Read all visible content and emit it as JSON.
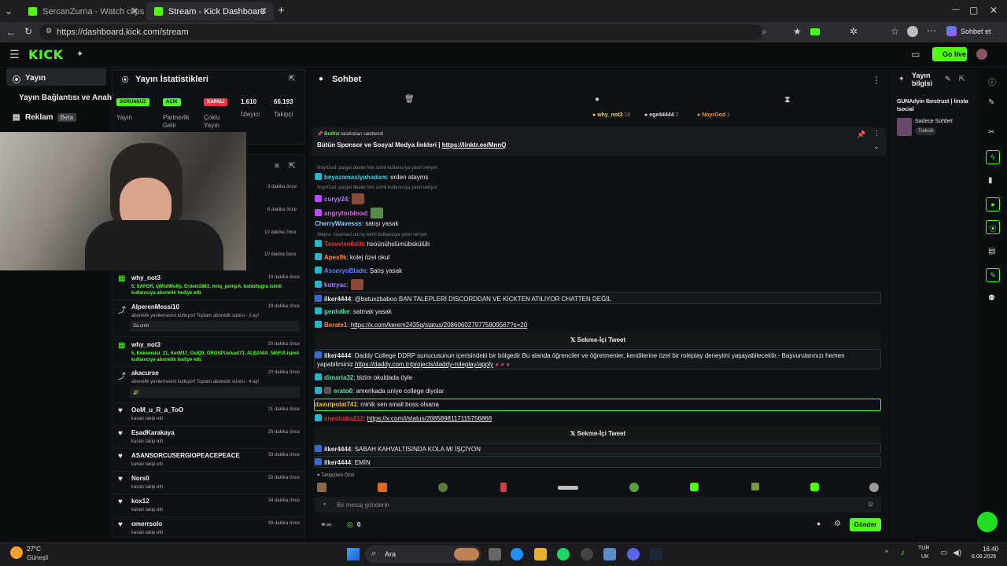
{
  "browser": {
    "tabs": [
      {
        "label": "SercanZurna - Watch clips on Kick"
      },
      {
        "label": "Stream - Kick Dashboard"
      }
    ],
    "url": "https://dashboard.kick.com/stream",
    "profile_label": "Sohbet et"
  },
  "header": {
    "logo": "KICK",
    "go_live": "Go live"
  },
  "sidebar": {
    "items": [
      {
        "label": "Yayın"
      },
      {
        "label": "Yayın Bağlantısı ve Anahtarı"
      },
      {
        "label": "Reklam",
        "badge": "Beta"
      }
    ]
  },
  "stats": {
    "title": "Yayın İstatistikleri",
    "cells": [
      {
        "badge": "SORUNSUZ",
        "label": "Yayın"
      },
      {
        "badge": "AÇIK",
        "label": "Partnerlik Gelir"
      },
      {
        "badge": "KAPALI",
        "label": "Çoklu Yayın"
      },
      {
        "value": "1.610",
        "label": "İzleyici"
      },
      {
        "value": "66.193",
        "label": "Takipçi"
      }
    ]
  },
  "activity": {
    "times_top": [
      "3 dakika önce",
      "6 dakika önce",
      "10 dakika önce",
      "10 dakika önce"
    ],
    "events": [
      {
        "user": "why_not3",
        "sub": "5, SAFOR, qWildWolfp, Erdem3883, mnq_pompA, hobbitugra isimli kullanıcıya abonelik hediye etti.",
        "time": "19 dakika önce"
      },
      {
        "user": "AlperenMessi10",
        "sub": "abonelik yenilemesini kutluyor! Toplam abonelik süresi - 3 ay!",
        "time": "19 dakika önce",
        "msg": "Sa cnm"
      },
      {
        "user": "why_not3",
        "sub": "5, Kekemsisi_21, KerM17, OsiQ9, OROSPUelvad73, ALBANIA_MAFIA isimli kullanıcıya abonelik hediye etti.",
        "time": "20 dakika önce"
      },
      {
        "user": "akacurse",
        "sub": "abonelik yenilemesini kutluyor! Toplam abonelik süresi - 4 ay!",
        "time": "20 dakika önce",
        "msg": "🎉"
      },
      {
        "user": "OoM_u_R_a_ToO",
        "sub": "kanalı takip etti",
        "time": "21 dakika önce"
      },
      {
        "user": "EsadKarakaya",
        "sub": "kanalı takip etti",
        "time": "25 dakika önce"
      },
      {
        "user": "ASANSORCUSERGIOPEACEPEACE",
        "sub": "kanalı takip etti",
        "time": "33 dakika önce"
      },
      {
        "user": "Nors0",
        "sub": "kanalı takip etti",
        "time": "33 dakika önce"
      },
      {
        "user": "kox12",
        "sub": "kanalı takip etti",
        "time": "34 dakika önce"
      },
      {
        "user": "omerrsolo",
        "sub": "kanalı takip etti",
        "time": "39 dakika önce"
      }
    ]
  },
  "chat": {
    "title": "Sohbet",
    "top_gifters": [
      {
        "name": "why_not3",
        "count": "16"
      },
      {
        "name": "ege44444",
        "count": "2"
      },
      {
        "name": "NoyrGod",
        "count": "1"
      }
    ],
    "pinned_by": "BotRix",
    "pinned_by_suffix": "tarafından sabitlendi",
    "pinned_text": "Bütün Sponsor ve Sosyal Medya linkleri |",
    "pinned_link": "https://linktr.ee/MnnQ",
    "messages": [
      {
        "reply": "NoyrGod: pargel dealer kim isimli kullanıcıya yanıt veriyor"
      },
      {
        "user": "beyazamasiyahadam",
        "text": "erden atayms"
      },
      {
        "reply": "NoyrGod: pargel dealer kim isimli kullanıcıya yanıt veriyor"
      },
      {
        "user": "curyy24",
        "text": ""
      },
      {
        "user": "angryforblood",
        "text": ""
      },
      {
        "user": "CherryWavesss",
        "text": "satışı yasak"
      },
      {
        "reply": "Aleyra: nisantasi uni rp isimli kullanıcıya yanıt veriyor"
      },
      {
        "user": "Tasvelen8dilt",
        "text": "hsoünühslümübskülüb"
      },
      {
        "user": "Apex9k",
        "text": "kolej özel okul"
      },
      {
        "user": "AsseryoBlade",
        "text": "Şatış yasak"
      },
      {
        "user": "kotryac",
        "text": ""
      },
      {
        "user": "ilker4444",
        "text": "@batuxzbaboo BAN TALEPLERİ DİSCORDDAN VE KİCKTEN ATILIYOR CHATTEN DEĞİL"
      },
      {
        "user": "genlolke",
        "text": "satmak yasak"
      },
      {
        "user": "Berate1",
        "link": "https://x.com/kerem2435q/status/2086060279775809567?s=20"
      },
      {
        "tweet": "Sekme-İçi Tweet"
      },
      {
        "user": "ilker4444",
        "text": "Daddy College DDRP sunucusunun içerisindeki bir bölgedir Bu alanda öğrenciler ve öğretmenler, kendilerine özel bir roleplay deneyimi yaşayabilecektir.- Başvurularınızı hemen"
      },
      {
        "text2": "yapabilirsiniz",
        "link": "https://daddy.com.tr/projects/daddy-roleplay/apply"
      },
      {
        "user": "dimaria32",
        "text": "bizim okuldada öyle"
      },
      {
        "user": "erato0",
        "text": "amerikada uniye college diyolar"
      },
      {
        "user": "davutpolat741",
        "text": "minik sen small boss olsana"
      },
      {
        "user": "enesbaba212",
        "link": "https://x.com/i/status/2085898117115756868"
      },
      {
        "tweet": "Sekme-İçi Tweet"
      },
      {
        "user": "ilker4444",
        "text": "SABAH KAHVALTISINDA KOLA MI İŞÇİYON"
      },
      {
        "user": "ilker4444",
        "text": "EMİN"
      }
    ],
    "emote_section": "Takipçilere Özel",
    "input_placeholder": "Bir mesaj gönderin",
    "send_label": "Gönder",
    "count": "0"
  },
  "stream_info": {
    "title": "Yayın bilgisi",
    "stream_title": "GUNAdyin Ibestrust | linsta Isocial",
    "category": "Sadece Sohbet",
    "tag": "Turkish"
  },
  "taskbar": {
    "weather_temp": "27°C",
    "weather_desc": "Güneşli",
    "search": "Ara",
    "lang": "TUR",
    "lang2": "UK",
    "time": "16:40",
    "date": "8.08.2026"
  },
  "colors": {
    "accent": "#53fc18",
    "bg": "#0b0e0f"
  }
}
